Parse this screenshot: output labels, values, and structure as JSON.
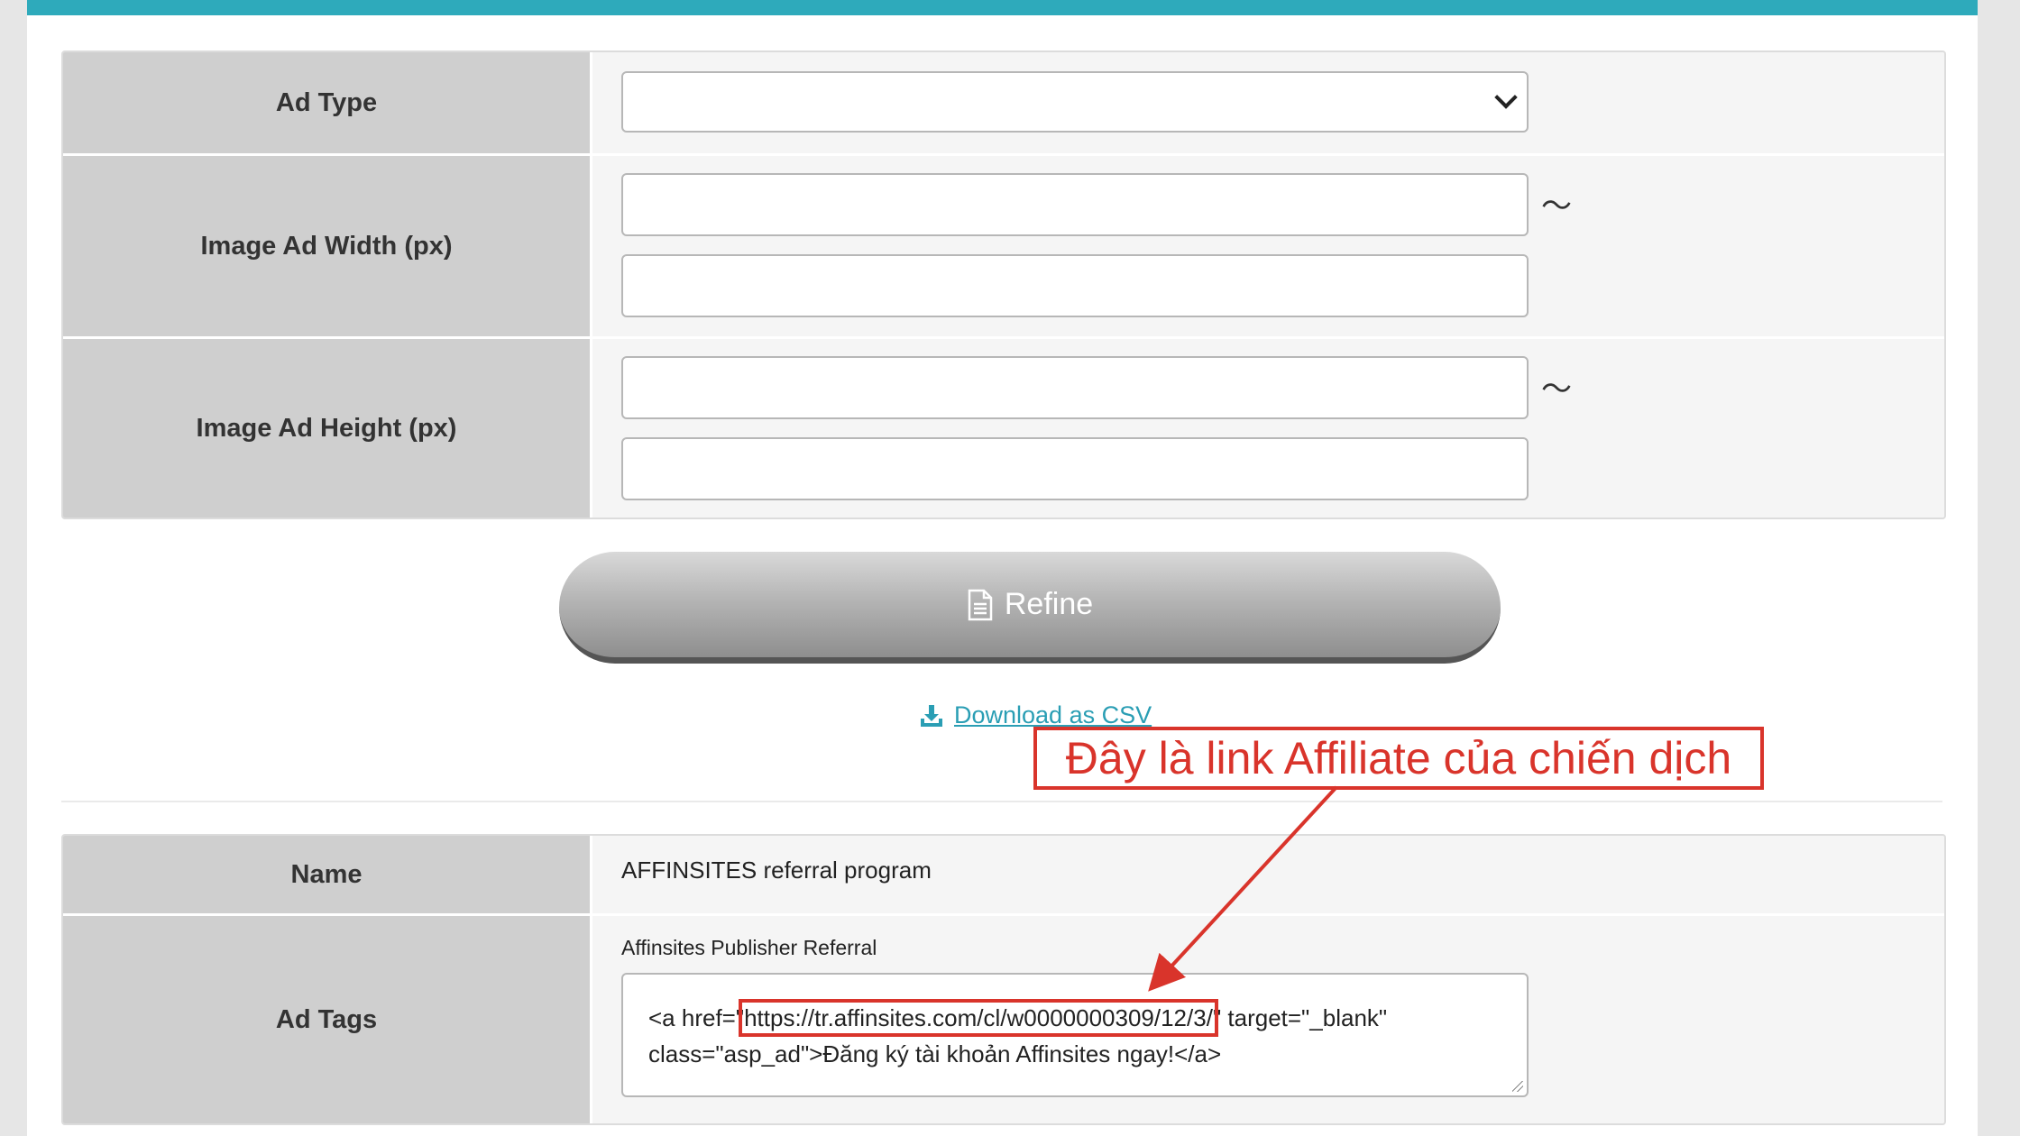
{
  "search_form": {
    "ad_type": {
      "label": "Ad Type",
      "selected": ""
    },
    "width": {
      "label": "Image Ad Width (px)",
      "min": "",
      "max": "",
      "range_sep": "〜"
    },
    "height": {
      "label": "Image Ad Height (px)",
      "min": "",
      "max": "",
      "range_sep": "〜"
    }
  },
  "actions": {
    "refine_label": "Refine",
    "refine_icon": "document-icon",
    "csv_label": "Download as CSV",
    "csv_icon": "download-icon"
  },
  "result": {
    "name_label": "Name",
    "name_value": "AFFINSITES referral program",
    "tags_label": "Ad Tags",
    "tag_title": "Affinsites Publisher Referral",
    "code_prefix": "<a href=\"",
    "code_url": "https://tr.affinsites.com/cl/w0000000309/12/3/",
    "code_suffix_1": "\" target=\"_blank\"",
    "code_line_2": "class=\"asp_ad\">Đăng ký tài khoản Affinsites ngay!</a>"
  },
  "annotation": {
    "text": "Đây là link Affiliate của chiến dịch",
    "color": "#d9342b"
  },
  "theme": {
    "accent": "#2eaabb",
    "link": "#2a9eb4"
  }
}
